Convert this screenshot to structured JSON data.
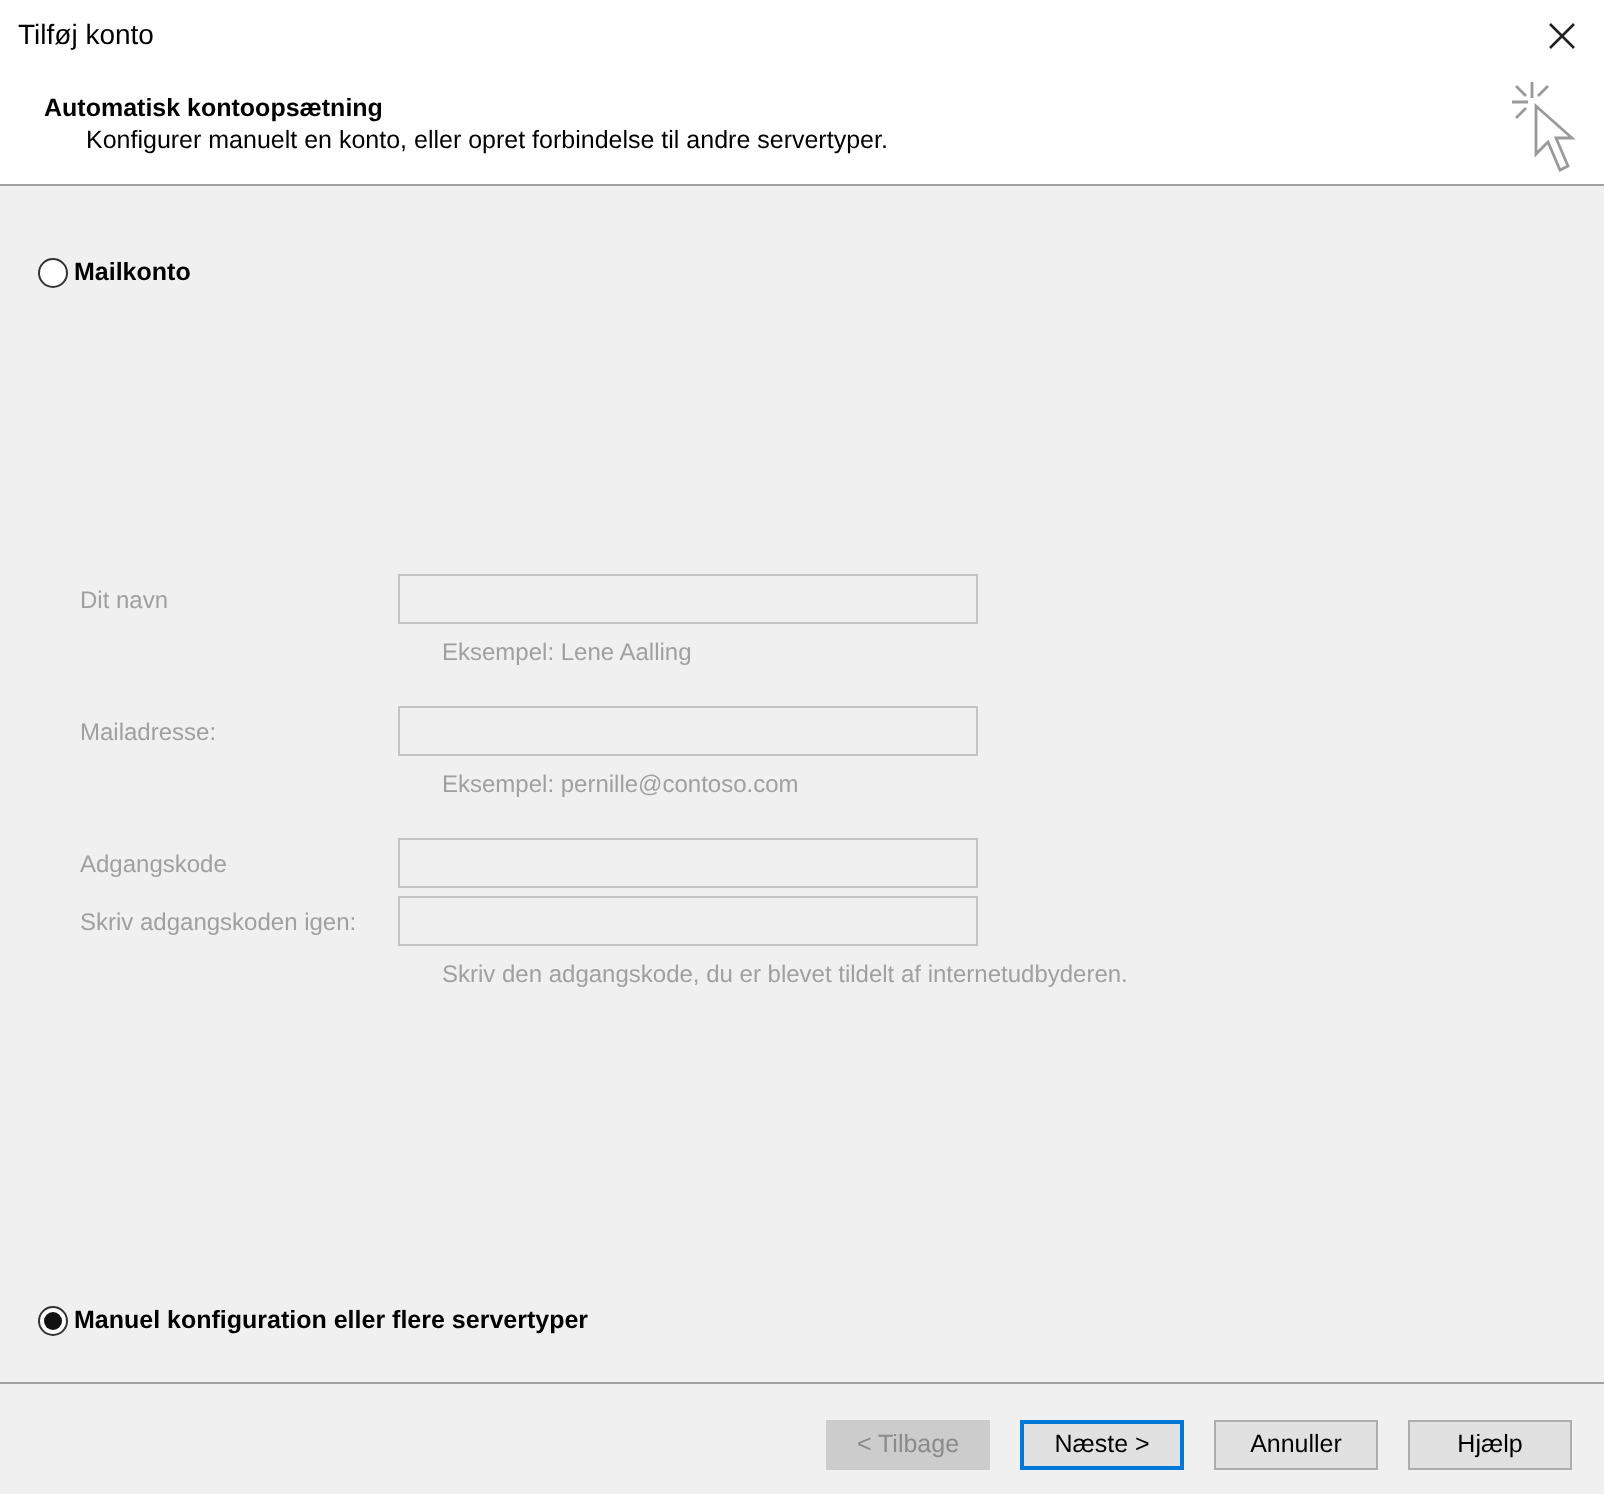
{
  "window": {
    "title": "Tilføj konto"
  },
  "header": {
    "title": "Automatisk kontoopsætning",
    "subtitle": "Konfigurer manuelt en konto, eller opret forbindelse til andre servertyper."
  },
  "options": [
    {
      "label": "Mailkonto",
      "selected": false
    },
    {
      "label": "Manuel konfiguration eller flere servertyper",
      "selected": true
    }
  ],
  "fields": [
    {
      "label": "Dit navn",
      "hint": "Eksempel: Lene Aalling",
      "disabled": true
    },
    {
      "label": "Mailadresse:",
      "hint": "Eksempel: pernille@contoso.com",
      "disabled": true
    },
    {
      "label": "Adgangskode",
      "disabled": true
    },
    {
      "label": "Skriv adgangskoden igen:",
      "hint": "Skriv den adgangskode, du er blevet tildelt af internetudbyderen.",
      "disabled": true
    }
  ],
  "buttons": [
    {
      "label": "< Tilbage",
      "disabled": true,
      "default": false
    },
    {
      "label": "Næste >",
      "disabled": false,
      "default": true
    },
    {
      "label": "Annuller",
      "disabled": false,
      "default": false
    },
    {
      "label": "Hjælp",
      "disabled": false,
      "default": false
    }
  ]
}
